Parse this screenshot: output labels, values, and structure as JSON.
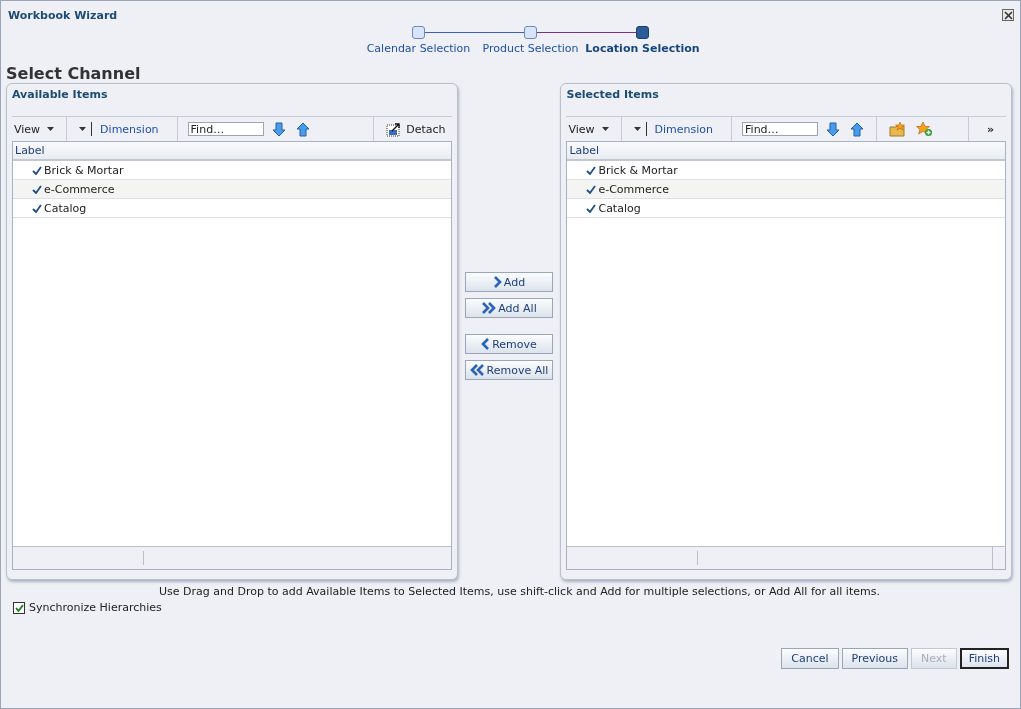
{
  "window": {
    "title": "Workbook Wizard"
  },
  "train": [
    {
      "label": "Calendar Selection",
      "selected": false
    },
    {
      "label": "Product Selection",
      "selected": false
    },
    {
      "label": "Location Selection",
      "selected": true
    }
  ],
  "heading": "Select Channel",
  "panels": [
    {
      "kind": "available",
      "title": "Available Items",
      "view": "View",
      "dimension": "Dimension",
      "find_placeholder": "Find…",
      "detach": "Detach",
      "column": "Label",
      "rows": [
        {
          "label": "Brick & Mortar",
          "checked": true
        },
        {
          "label": "e-Commerce",
          "checked": true
        },
        {
          "label": "Catalog",
          "checked": true
        }
      ]
    },
    {
      "kind": "selected",
      "title": "Selected Items",
      "view": "View",
      "dimension": "Dimension",
      "find_placeholder": "Find…",
      "overflow": "»",
      "column": "Label",
      "rows": [
        {
          "label": "Brick & Mortar",
          "checked": true
        },
        {
          "label": "e-Commerce",
          "checked": true
        },
        {
          "label": "Catalog",
          "checked": true
        }
      ]
    }
  ],
  "shuttle": [
    {
      "kind": "add",
      "label": "Add"
    },
    {
      "kind": "add_all",
      "label": "Add All"
    },
    {
      "kind": "remove",
      "label": "Remove"
    },
    {
      "kind": "remove_all",
      "label": "Remove All"
    }
  ],
  "help": "Use Drag and Drop to add Available Items to Selected Items, use shift-click and Add for multiple selections, or Add All for all items.",
  "sync": {
    "label": "Synchronize Hierarchies",
    "checked": true
  },
  "buttons": [
    {
      "label": "Cancel",
      "disabled": false,
      "default": false
    },
    {
      "label": "Previous",
      "disabled": false,
      "default": false
    },
    {
      "label": "Next",
      "disabled": true,
      "default": false
    },
    {
      "label": "Finish",
      "disabled": false,
      "default": true
    }
  ]
}
